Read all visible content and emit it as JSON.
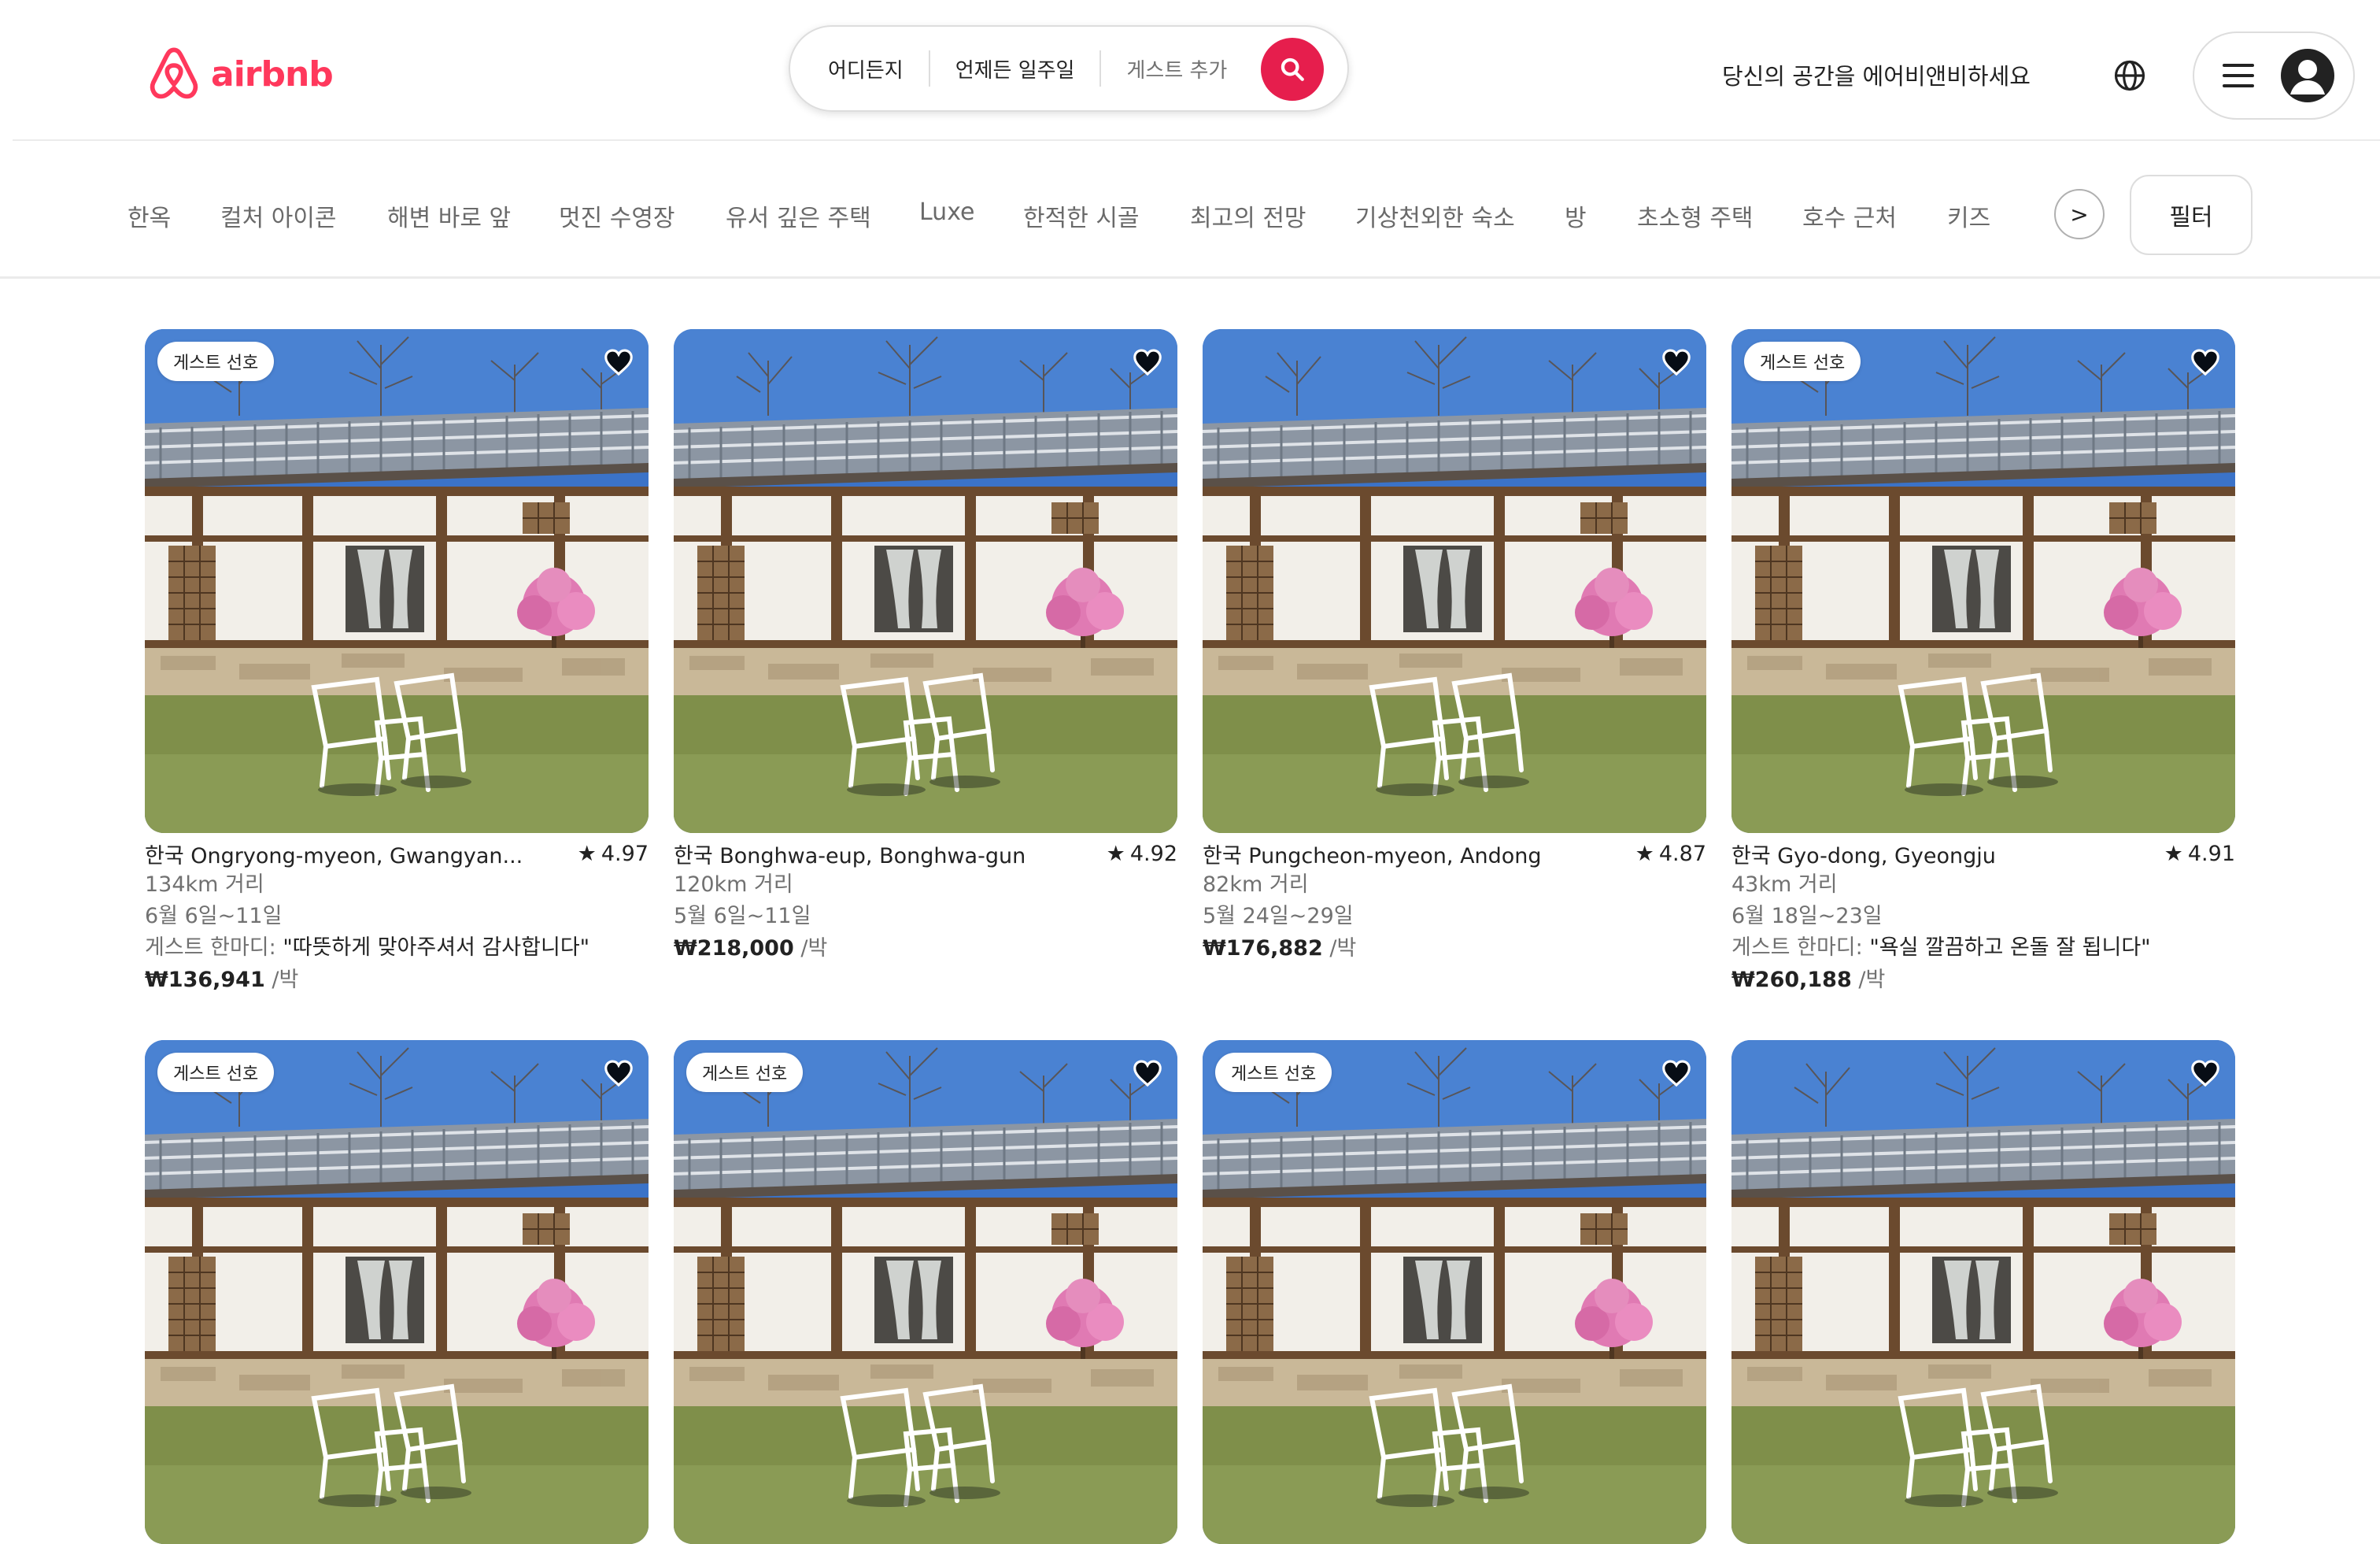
{
  "brand": {
    "name": "airbnb",
    "color": "#FF385C"
  },
  "search": {
    "where": "어디든지",
    "when": "언제든 일주일",
    "guests_placeholder": "게스트 추가",
    "button_color": "#E61E4D"
  },
  "header": {
    "host_link": "당신의 공간을 에어비앤비하세요",
    "globe_icon": "globe-icon",
    "menu_icon": "hamburger-icon",
    "avatar_icon": "user-avatar-icon"
  },
  "categories": {
    "items": [
      "한옥",
      "컬처 아이콘",
      "해변 바로 앞",
      "멋진 수영장",
      "유서 깊은 주택",
      "Luxe",
      "한적한 시골",
      "최고의 전망",
      "기상천외한 숙소",
      "방",
      "초소형 주택",
      "호수 근처",
      "키즈"
    ],
    "next_label": ">",
    "filter_label": "필터"
  },
  "listings": [
    {
      "badge": "게스트 선호",
      "location": "한국 Ongryong-myeon, Gwangyan...",
      "rating": "4.97",
      "distance": "134km 거리",
      "dates": "6월 6일~11일",
      "review_label": "게스트 한마디:",
      "review_text": "\"따뜻하게 맞아주셔서 감사합니다\"",
      "price": "₩136,941",
      "unit": "/박"
    },
    {
      "badge": "",
      "location": "한국 Bonghwa-eup, Bonghwa-gun",
      "rating": "4.92",
      "distance": "120km 거리",
      "dates": "5월 6일~11일",
      "review_label": "",
      "review_text": "",
      "price": "₩218,000",
      "unit": "/박"
    },
    {
      "badge": "",
      "location": "한국 Pungcheon-myeon, Andong",
      "rating": "4.87",
      "distance": "82km 거리",
      "dates": "5월 24일~29일",
      "review_label": "",
      "review_text": "",
      "price": "₩176,882",
      "unit": "/박"
    },
    {
      "badge": "게스트 선호",
      "location": "한국 Gyo-dong, Gyeongju",
      "rating": "4.91",
      "distance": "43km 거리",
      "dates": "6월 18일~23일",
      "review_label": "게스트 한마디:",
      "review_text": "\"욕실 깔끔하고 온돌 잘 됩니다\"",
      "price": "₩260,188",
      "unit": "/박"
    },
    {
      "badge": "게스트 선호"
    },
    {
      "badge": "게스트 선호"
    },
    {
      "badge": "게스트 선호"
    },
    {
      "badge": ""
    }
  ]
}
